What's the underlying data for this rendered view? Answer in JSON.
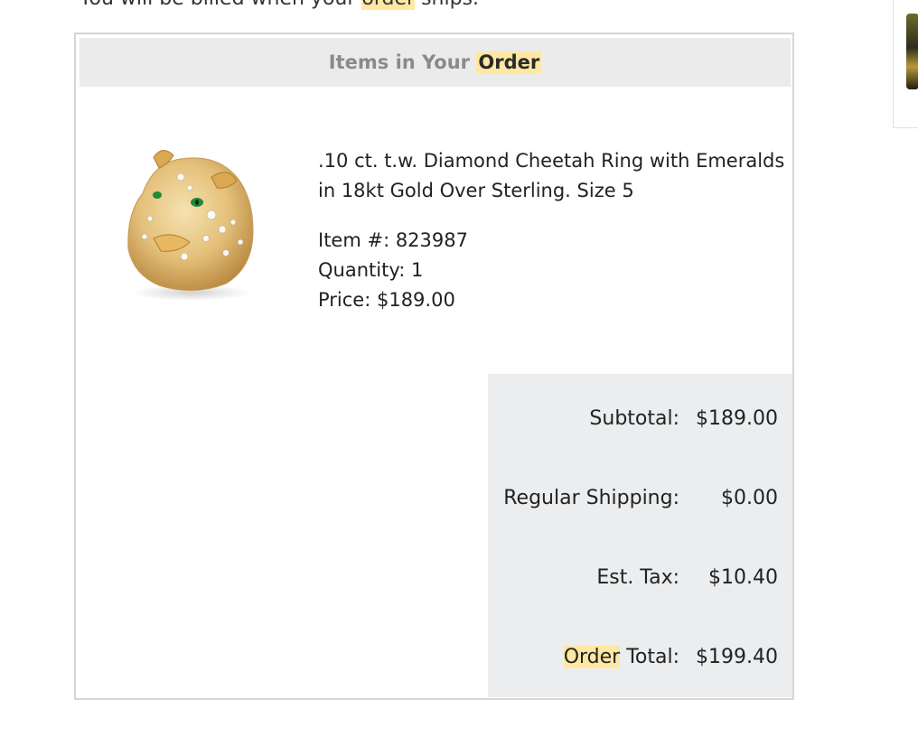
{
  "top_notice": {
    "before": "You will be billed when your ",
    "highlight": "order",
    "after": " ships."
  },
  "order": {
    "header_prefix": "Items in Your ",
    "header_highlight": "Order",
    "item": {
      "title": ".10 ct. t.w. Diamond Cheetah Ring with Emeralds in 18kt Gold Over Sterling. Size 5",
      "item_number": "Item #: 823987",
      "quantity": "Quantity: 1",
      "price": "Price: $189.00",
      "image_icon": "cheetah-ring-image"
    },
    "totals": {
      "subtotal_label": "Subtotal:",
      "subtotal_value": "$189.00",
      "shipping_label": "Regular Shipping:",
      "shipping_value": "$0.00",
      "tax_label": "Est. Tax:",
      "tax_value": "$10.40",
      "total_label_highlight": "Order",
      "total_label_rest": " Total:",
      "total_value": "$199.40"
    }
  },
  "colors": {
    "highlight": "#fde7a3",
    "header_bg": "#ebebeb",
    "totals_bg": "#ebedef",
    "border": "#d6d6d6"
  }
}
